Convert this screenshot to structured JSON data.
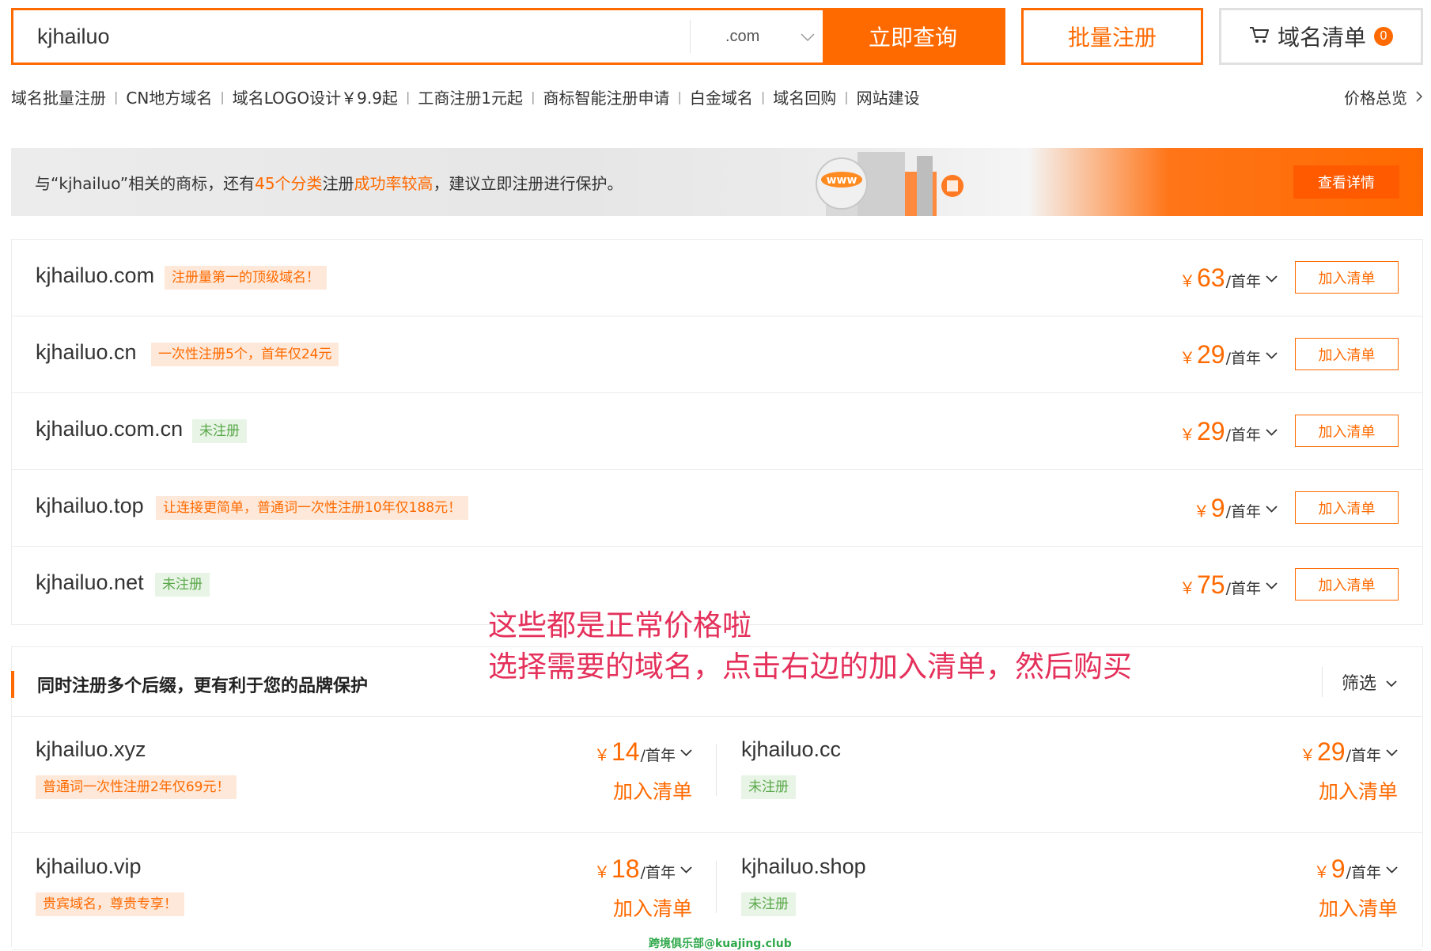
{
  "search": {
    "value": "kjhailuo",
    "suffix": ".com",
    "search_button": "立即查询"
  },
  "header_buttons": {
    "batch_register": "批量注册",
    "cart_label": "域名清单",
    "cart_count": "0"
  },
  "quick_links": {
    "items": [
      "域名批量注册",
      "CN地方域名",
      "域名LOGO设计￥9.9起",
      "工商注册1元起",
      "商标智能注册申请",
      "白金域名",
      "域名回购",
      "网站建设"
    ],
    "separator": "|",
    "price_overview": "价格总览"
  },
  "banner": {
    "text_prefix": "与“kjhailuo”相关的商标，还有",
    "highlight1": "45个分类",
    "text_mid": "注册",
    "highlight2": "成功率较高",
    "text_suffix": "，建议立即注册进行保护。",
    "art_label": "www",
    "button": "查看详情"
  },
  "domain_list": [
    {
      "name": "kjhailuo.com",
      "tag": "注册量第一的顶级域名！",
      "tag_style": "orange",
      "currency": "￥",
      "price": "63",
      "unit": "/首年",
      "button": "加入清单"
    },
    {
      "name": "kjhailuo.cn",
      "tag": "一次性注册5个，首年仅24元",
      "tag_style": "orange",
      "currency": "￥",
      "price": "29",
      "unit": "/首年",
      "button": "加入清单"
    },
    {
      "name": "kjhailuo.com.cn",
      "tag": "未注册",
      "tag_style": "green",
      "currency": "￥",
      "price": "29",
      "unit": "/首年",
      "button": "加入清单"
    },
    {
      "name": "kjhailuo.top",
      "tag": "让连接更简单，普通词一次性注册10年仅188元！",
      "tag_style": "orange",
      "currency": "￥",
      "price": "9",
      "unit": "/首年",
      "button": "加入清单"
    },
    {
      "name": "kjhailuo.net",
      "tag": "未注册",
      "tag_style": "green",
      "currency": "￥",
      "price": "75",
      "unit": "/首年",
      "button": "加入清单"
    }
  ],
  "annotation": {
    "line1": "这些都是正常价格啦",
    "line2": "选择需要的域名，点击右边的加入清单，然后购买"
  },
  "multi_suffix": {
    "title": "同时注册多个后缀，更有利于您的品牌保护",
    "filter": "筛选",
    "rows": [
      [
        {
          "name": "kjhailuo.xyz",
          "tag": "普通词一次性注册2年仅69元！",
          "tag_style": "orange",
          "currency": "￥",
          "price": "14",
          "unit": "/首年",
          "button": "加入清单"
        },
        {
          "name": "kjhailuo.cc",
          "tag": "未注册",
          "tag_style": "green",
          "currency": "￥",
          "price": "29",
          "unit": "/首年",
          "button": "加入清单"
        }
      ],
      [
        {
          "name": "kjhailuo.vip",
          "tag": "贵宾域名，尊贵专享！",
          "tag_style": "orange",
          "currency": "￥",
          "price": "18",
          "unit": "/首年",
          "button": "加入清单"
        },
        {
          "name": "kjhailuo.shop",
          "tag": "未注册",
          "tag_style": "green",
          "currency": "￥",
          "price": "9",
          "unit": "/首年",
          "button": "加入清单"
        }
      ]
    ]
  },
  "watermark": "跨境俱乐部@kuajing.club",
  "colors": {
    "accent": "#ff6a00",
    "annotation": "#e4305a",
    "tag_green": "#5aa84a",
    "tag_orange_bg": "#fde8d9"
  },
  "icons": [
    "chevron-down-icon",
    "cart-icon",
    "chevron-right-icon"
  ]
}
